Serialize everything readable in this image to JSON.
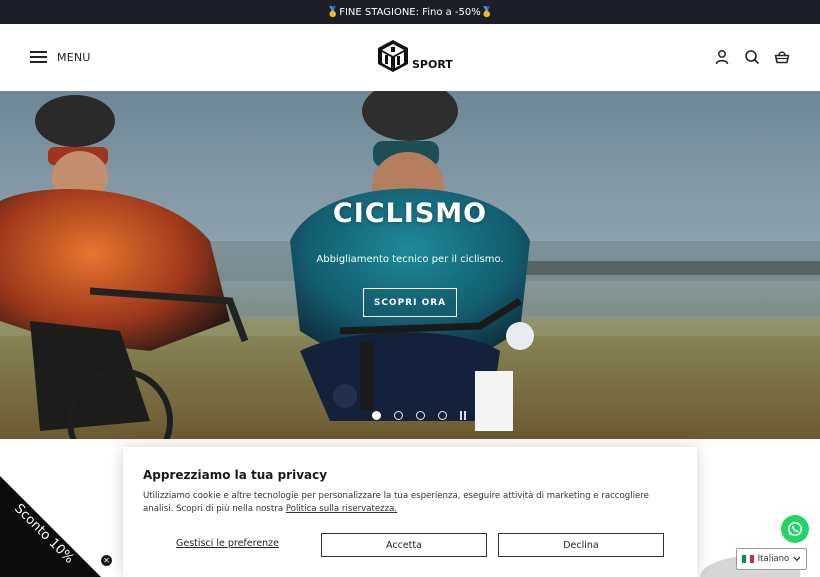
{
  "announcement": {
    "text": "🥇FINE STAGIONE: Fino a -50%🥇"
  },
  "header": {
    "menu_label": "MENU",
    "logo_text": "SPORT",
    "icons": [
      "account-icon",
      "search-icon",
      "cart-icon"
    ]
  },
  "hero": {
    "title": "CICLISMO",
    "subtitle": "Abbigliamento tecnico per il ciclismo.",
    "button_label": "SCOPRI ORA",
    "slides_total": 4,
    "active_slide": 1
  },
  "cookie": {
    "title": "Apprezziamo la tua privacy",
    "text": "Utilizziamo cookie e altre tecnologie per personalizzare la tua esperienza, eseguire attività di marketing e raccogliere analisi. Scopri di più nella nostra",
    "link_text": "Politica sulla riservatezza.",
    "manage_label": "Gestisci le preferenze",
    "accept_label": "Accetta",
    "decline_label": "Declina"
  },
  "discount_badge": {
    "text": "Sconto 10%"
  },
  "language": {
    "label": "Italiano"
  },
  "colors": {
    "announcement_bg": "#1d1f28",
    "whatsapp": "#25d366",
    "accent_text": "#ffffff"
  }
}
